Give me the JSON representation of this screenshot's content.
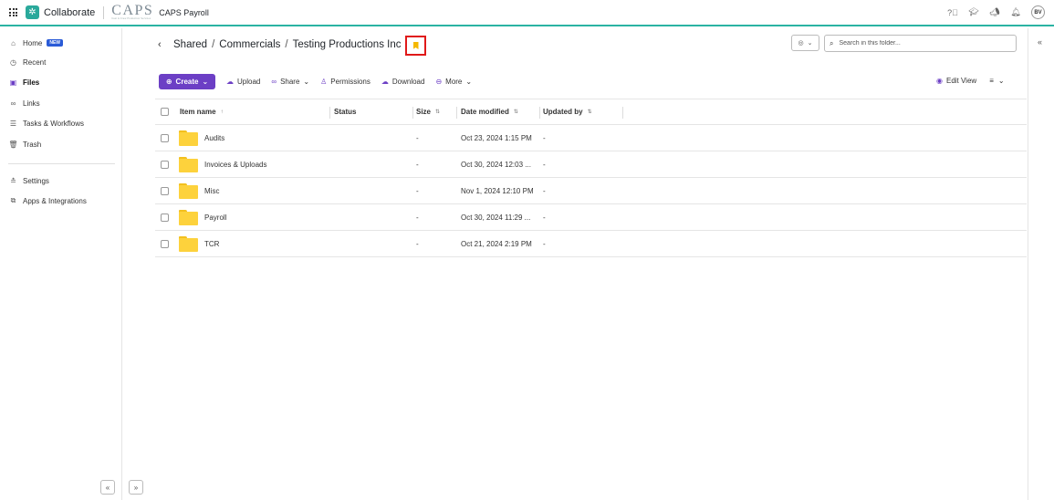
{
  "topbar": {
    "app_name": "Collaborate",
    "brand": "CAPS",
    "brand_tagline": "Cast & Crew Production Services",
    "org_name": "CAPS Payroll",
    "user_initials": "BV",
    "icons": [
      "help-icon",
      "graduation-cap-icon",
      "megaphone-icon",
      "bell-icon"
    ]
  },
  "sidebar": {
    "items": [
      {
        "label": "Home",
        "icon": "home-icon",
        "badge": "NEW"
      },
      {
        "label": "Recent",
        "icon": "clock-icon"
      },
      {
        "label": "Files",
        "icon": "files-icon",
        "active": true
      },
      {
        "label": "Links",
        "icon": "link-icon"
      },
      {
        "label": "Tasks & Workflows",
        "icon": "tasks-icon"
      },
      {
        "label": "Trash",
        "icon": "trash-icon"
      }
    ],
    "bottom_items": [
      {
        "label": "Settings",
        "icon": "sliders-icon"
      },
      {
        "label": "Apps & Integrations",
        "icon": "apps-icon"
      }
    ]
  },
  "breadcrumb": {
    "items": [
      "Shared",
      "Commercials",
      "Testing Productions Inc"
    ],
    "separator": "/"
  },
  "search": {
    "placeholder": "Search in this folder..."
  },
  "toolbar": {
    "create_label": "Create",
    "upload_label": "Upload",
    "share_label": "Share",
    "permissions_label": "Permissions",
    "download_label": "Download",
    "more_label": "More",
    "edit_view_label": "Edit View"
  },
  "table": {
    "columns": [
      "Item name",
      "Status",
      "Size",
      "Date modified",
      "Updated by"
    ],
    "rows": [
      {
        "name": "Audits",
        "size": "-",
        "modified": "Oct 23, 2024 1:15 PM",
        "updated_by": "-"
      },
      {
        "name": "Invoices & Uploads",
        "size": "-",
        "modified": "Oct 30, 2024 12:03 ...",
        "updated_by": "-"
      },
      {
        "name": "Misc",
        "size": "-",
        "modified": "Nov 1, 2024 12:10 PM",
        "updated_by": "-"
      },
      {
        "name": "Payroll",
        "size": "-",
        "modified": "Oct 30, 2024 11:29 ...",
        "updated_by": "-"
      },
      {
        "name": "TCR",
        "size": "-",
        "modified": "Oct 21, 2024 2:19 PM",
        "updated_by": "-"
      }
    ]
  },
  "colors": {
    "accent": "#6c3fc5",
    "brand_teal": "#2aa99b",
    "bookmark": "#f5b800",
    "highlight_box": "#e01919",
    "folder": "#fdd23c",
    "new_badge": "#2a5bd7"
  }
}
